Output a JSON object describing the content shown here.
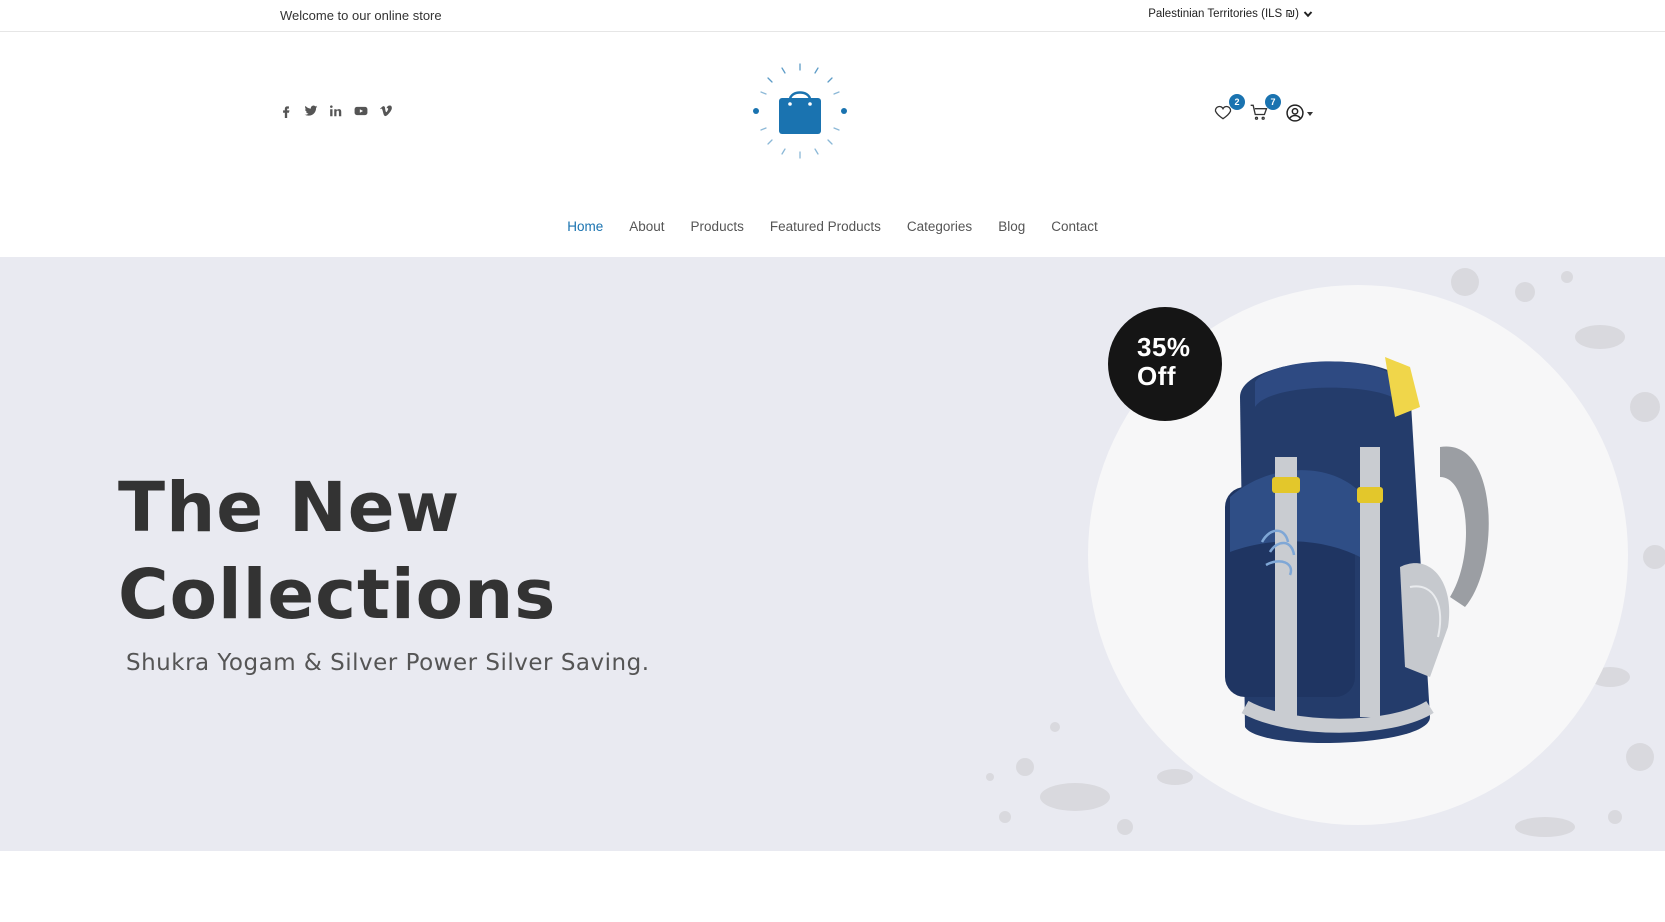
{
  "topbar": {
    "welcome": "Welcome to our online store",
    "region": "Palestinian Territories (ILS ₪)"
  },
  "header": {
    "socials": [
      "facebook-icon",
      "twitter-icon",
      "linkedin-icon",
      "youtube-icon",
      "vimeo-icon"
    ],
    "wishlist_count": "2",
    "cart_count": "7"
  },
  "nav": {
    "items": [
      {
        "label": "Home",
        "active": true
      },
      {
        "label": "About"
      },
      {
        "label": "Products"
      },
      {
        "label": "Featured Products"
      },
      {
        "label": "Categories"
      },
      {
        "label": "Blog"
      },
      {
        "label": "Contact"
      }
    ]
  },
  "hero": {
    "title_line1": "The New",
    "title_line2": "Collections",
    "subtitle": "Shukra Yogam & Silver Power Silver Saving.",
    "badge_line1": "35%",
    "badge_line2": "Off"
  },
  "colors": {
    "accent": "#1a73b0",
    "hero_bg": "#e9eaf1",
    "badge_bg": "#151515"
  }
}
